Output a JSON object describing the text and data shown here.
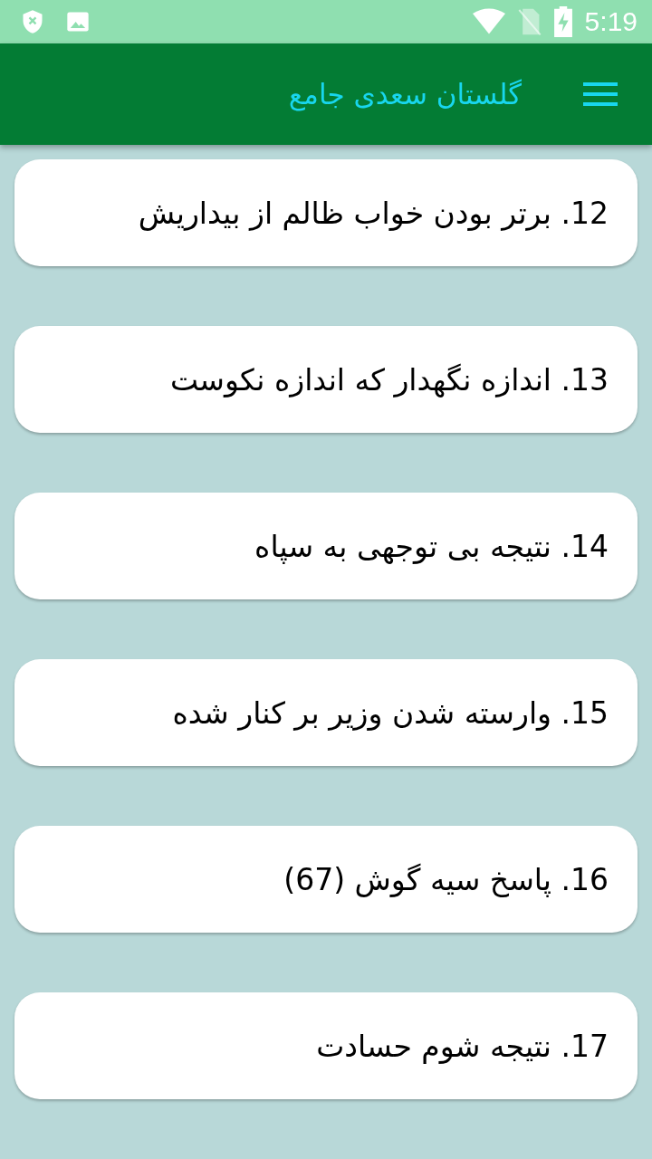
{
  "status_bar": {
    "time": "5:19"
  },
  "app_bar": {
    "title": "گلستان سعدی جامع"
  },
  "items": [
    {
      "title": "12. برتر بودن خواب ظالم از بیداریش"
    },
    {
      "title": "13. اندازه نگهدار که اندازه نکوست"
    },
    {
      "title": "14. نتیجه بی توجهی به سپاه"
    },
    {
      "title": "15. وارسته شدن وزیر بر کنار شده"
    },
    {
      "title": "16. پاسخ سیه گوش (67)"
    },
    {
      "title": "17. نتیجه شوم حسادت"
    }
  ]
}
